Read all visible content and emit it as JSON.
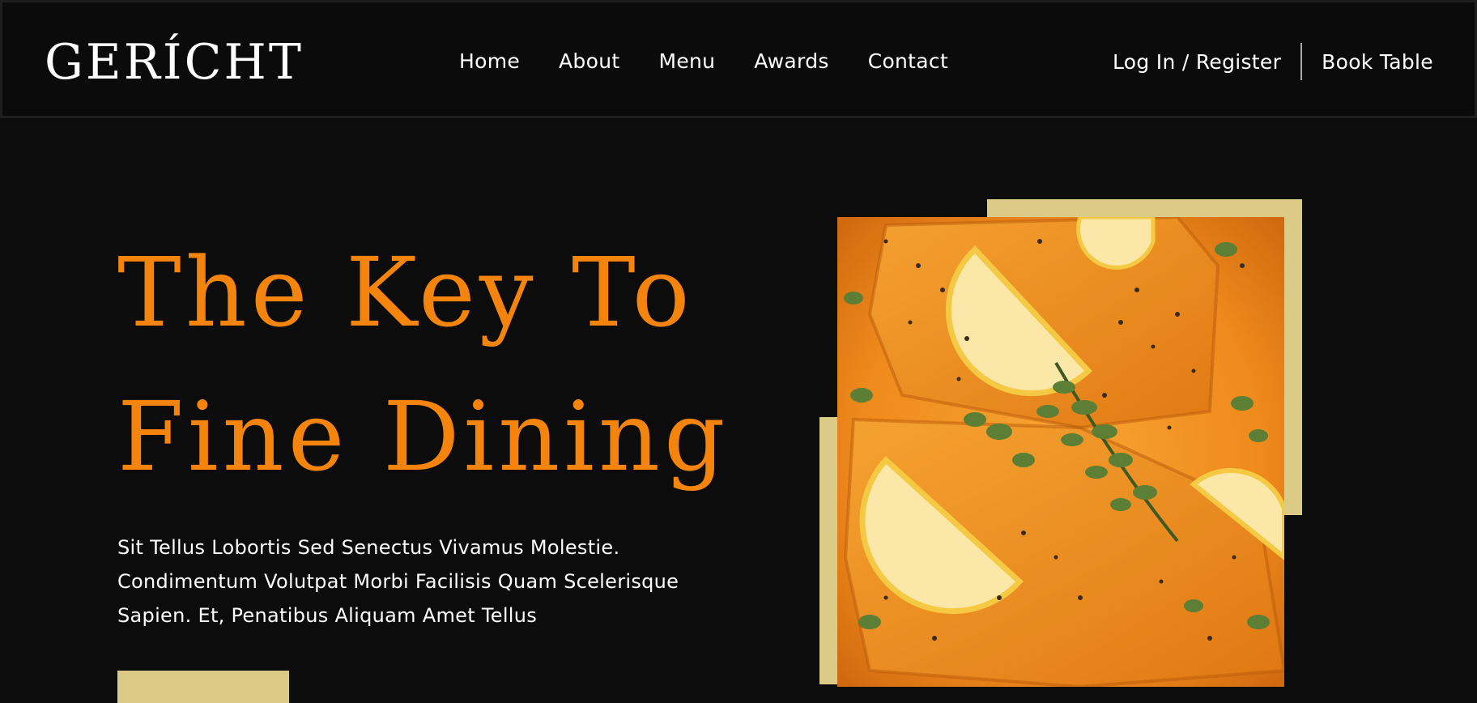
{
  "nav": {
    "logo": "GERÍCHT",
    "links": [
      "Home",
      "About",
      "Menu",
      "Awards",
      "Contact"
    ],
    "login": "Log In / Register",
    "book": "Book Table"
  },
  "hero": {
    "title_line1": "The Key To",
    "title_line2": "Fine Dining",
    "description": "Sit Tellus Lobortis Sed Senectus Vivamus Molestie. Condimentum Volutpat Morbi Facilisis Quam Scelerisque Sapien. Et, Penatibus Aliquam Amet Tellus"
  },
  "colors": {
    "background": "#0c0c0c",
    "accent_orange": "#f5840d",
    "accent_gold": "#dcca87",
    "text": "#ffffff"
  },
  "image": {
    "icon": "food-photo-icon"
  }
}
